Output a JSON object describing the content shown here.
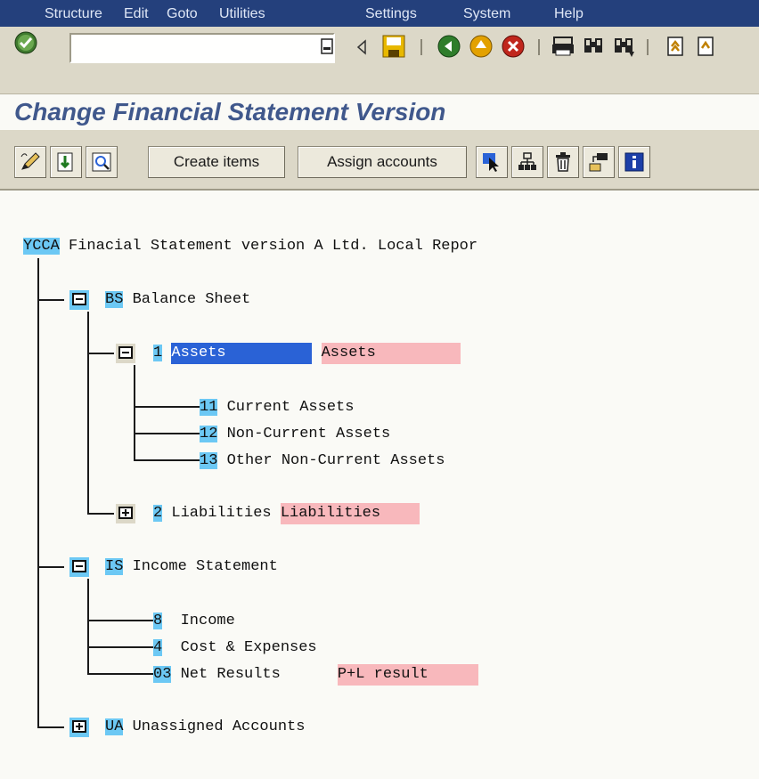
{
  "menu": {
    "items": [
      "Structure",
      "Edit",
      "Goto",
      "Utilities",
      "Settings",
      "System",
      "Help"
    ]
  },
  "toolbar": {
    "command_field_value": "",
    "icons": [
      "enter-icon",
      "command-history-icon",
      "back-arrow-icon",
      "save-icon",
      "back-icon",
      "exit-icon",
      "cancel-icon",
      "print-icon",
      "find-icon",
      "find-next-icon",
      "first-page-icon",
      "previous-page-icon"
    ]
  },
  "title": "Change Financial Statement Version",
  "app_toolbar": {
    "create_items_label": "Create items",
    "assign_accounts_label": "Assign accounts",
    "icons": [
      "edit-icon",
      "expand-icon",
      "display-icon",
      "select-icon",
      "hierarchy-icon",
      "delete-icon",
      "move-icon",
      "info-icon"
    ]
  },
  "colors": {
    "menubar": "#24407c",
    "toolbar": "#dcd8c8",
    "title": "#40588c",
    "code_highlight": "#6cc8f4",
    "selection": "#2a62d6",
    "note_highlight": "#f8b8bc"
  },
  "tree": {
    "root": {
      "code": "YCCA",
      "text": " Finacial Statement version A Ltd. Local Repor"
    },
    "bs": {
      "code": "BS",
      "text": " Balance Sheet"
    },
    "assets": {
      "code": "1",
      "text": "Assets",
      "note": "Assets"
    },
    "current_assets": {
      "code": "11",
      "text": " Current Assets"
    },
    "non_current_assets": {
      "code": "12",
      "text": " Non-Current Assets"
    },
    "other_non_current_assets": {
      "code": "13",
      "text": " Other Non-Current Assets"
    },
    "liabilities": {
      "code": "2",
      "text": " Liabilities ",
      "note": "Liabilities"
    },
    "is": {
      "code": "IS",
      "text": " Income Statement"
    },
    "income": {
      "code": "8",
      "text": "  Income"
    },
    "cost_expenses": {
      "code": "4",
      "text": "  Cost & Expenses"
    },
    "net_results": {
      "code": "03",
      "text": " Net Results",
      "note": "P+L result"
    },
    "ua": {
      "code": "UA",
      "text": " Unassigned Accounts"
    }
  }
}
